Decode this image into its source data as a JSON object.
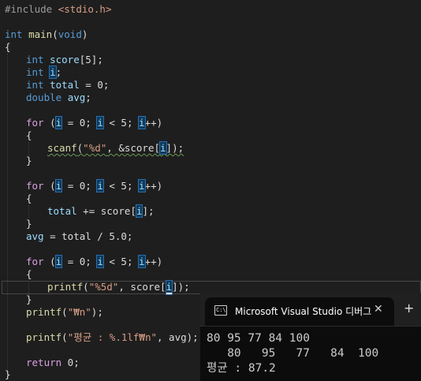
{
  "editor": {
    "lines": {
      "l1": {
        "pp": "#include",
        "inc": "<stdio.h>"
      },
      "l3": {
        "type": "int",
        "name": "main",
        "arg_open": "(",
        "arg": "void",
        "arg_close": ")"
      },
      "l4": "{",
      "l5": {
        "type": "int",
        "var": "score",
        "rest": "[5];"
      },
      "l6": {
        "type": "int",
        "var": "i",
        "rest": ";"
      },
      "l7": {
        "type": "int",
        "var": "total",
        "rest": " = 0;"
      },
      "l8": {
        "type": "double",
        "var": "avg",
        "rest": ";"
      },
      "l10": {
        "kw": "for",
        "text": " (i = 0; i < 5; i++)"
      },
      "l11": "{",
      "l12": {
        "fn": "scanf",
        "open": "(",
        "str": "\"%d\"",
        "mid": ", &score[",
        "i": "i",
        "end": "]);"
      },
      "l13": "}",
      "l15": {
        "kw": "for",
        "text": " (i = 0; i < 5; i++)"
      },
      "l16": "{",
      "l17": {
        "var": "total",
        "mid": " += score[",
        "i": "i",
        "end": "];"
      },
      "l18": "}",
      "l19": {
        "var": "avg",
        "mid": " = total / 5.0;"
      },
      "l21": {
        "kw": "for",
        "text": " (i = 0; i < 5; i++)"
      },
      "l22": "{",
      "l23": {
        "fn": "printf",
        "open": "(",
        "str": "\"%5d\"",
        "mid": ", score[",
        "i": "i",
        "end": "]);"
      },
      "l24": "}",
      "l25": {
        "fn": "printf",
        "open": "(",
        "str": "\"₩n\"",
        "end": ");"
      },
      "l27": {
        "fn": "printf",
        "open": "(",
        "str": "\"평균 : %.1lf₩n\"",
        "end": ", avg);"
      },
      "l29": {
        "kw": "return",
        "rest": " 0;"
      },
      "l30": "}"
    }
  },
  "console": {
    "title": "Microsoft Visual Studio 디버그",
    "icon_label": "C:\\",
    "close_icon": "close-icon",
    "new_tab_icon": "plus-icon",
    "output": [
      "80 95 77 84 100",
      "   80   95   77   84  100",
      "평균 : 87.2"
    ]
  },
  "colors": {
    "editor_bg": "#1e1e1e",
    "keyword": "#569cd6",
    "function": "#dcdcaa",
    "string": "#d69d85",
    "control": "#d8a0df",
    "console_bg": "#0c0c0c"
  }
}
